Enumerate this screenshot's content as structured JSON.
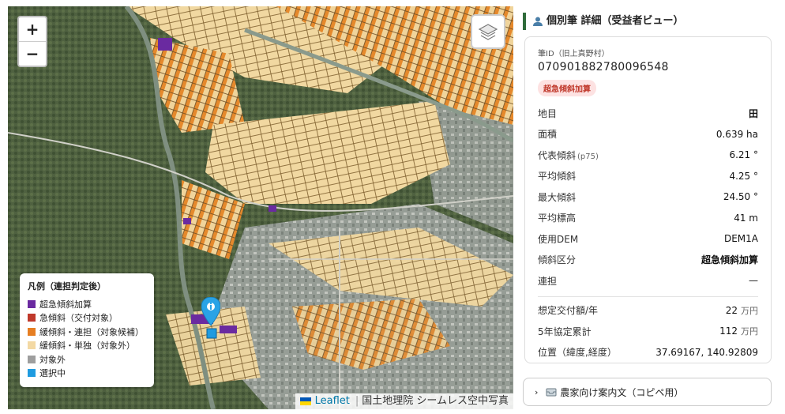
{
  "map": {
    "zoom_in": "+",
    "zoom_out": "−",
    "layers_icon": "layers-icon",
    "legend": {
      "title": "凡例（連担判定後）",
      "items": [
        {
          "label": "超急傾斜加算",
          "color": "#6a2aa0"
        },
        {
          "label": "急傾斜（交付対象）",
          "color": "#c0392b"
        },
        {
          "label": "緩傾斜・連担（対象候補）",
          "color": "#e67e22"
        },
        {
          "label": "緩傾斜・単独（対象外）",
          "color": "#f3d9a4"
        },
        {
          "label": "対象外",
          "color": "#9e9e9e"
        },
        {
          "label": "選択中",
          "color": "#1f9be0"
        }
      ]
    },
    "attribution": {
      "leaflet": "Leaflet",
      "separator": "|",
      "source": "国土地理院 シームレス空中写真"
    }
  },
  "panel": {
    "title": "個別筆 詳細（受益者ビュー）",
    "id_label": "筆ID（旧上真野村）",
    "id_value": "070901882780096548",
    "badge": "超急傾斜加算",
    "rows": [
      {
        "key": "地目",
        "value": "田",
        "bold": true
      },
      {
        "key": "面積",
        "value": "0.639 ha"
      },
      {
        "key": "代表傾斜",
        "key_note": "(p75)",
        "value": "6.21 °"
      },
      {
        "key": "平均傾斜",
        "value": "4.25 °"
      },
      {
        "key": "最大傾斜",
        "value": "24.50 °"
      },
      {
        "key": "平均標高",
        "value": "41 m"
      },
      {
        "key": "使用DEM",
        "value": "DEM1A"
      },
      {
        "key": "傾斜区分",
        "value": "超急傾斜加算",
        "bold": true
      },
      {
        "key": "連担",
        "value": "—"
      }
    ],
    "rows2": [
      {
        "key": "想定交付額/年",
        "num": "22",
        "unit": "万円"
      },
      {
        "key": "5年協定累計",
        "num": "112",
        "unit": "万円"
      },
      {
        "key": "位置（緯度,経度）",
        "num": "37.69167, 140.92809",
        "unit": ""
      }
    ],
    "guide": "農家向け案内文（コピペ用）"
  },
  "colors": {
    "accent": "#2f6b3a",
    "badge_bg": "#fde2e2",
    "badge_text": "#c0392b",
    "selected": "#1f9be0"
  }
}
